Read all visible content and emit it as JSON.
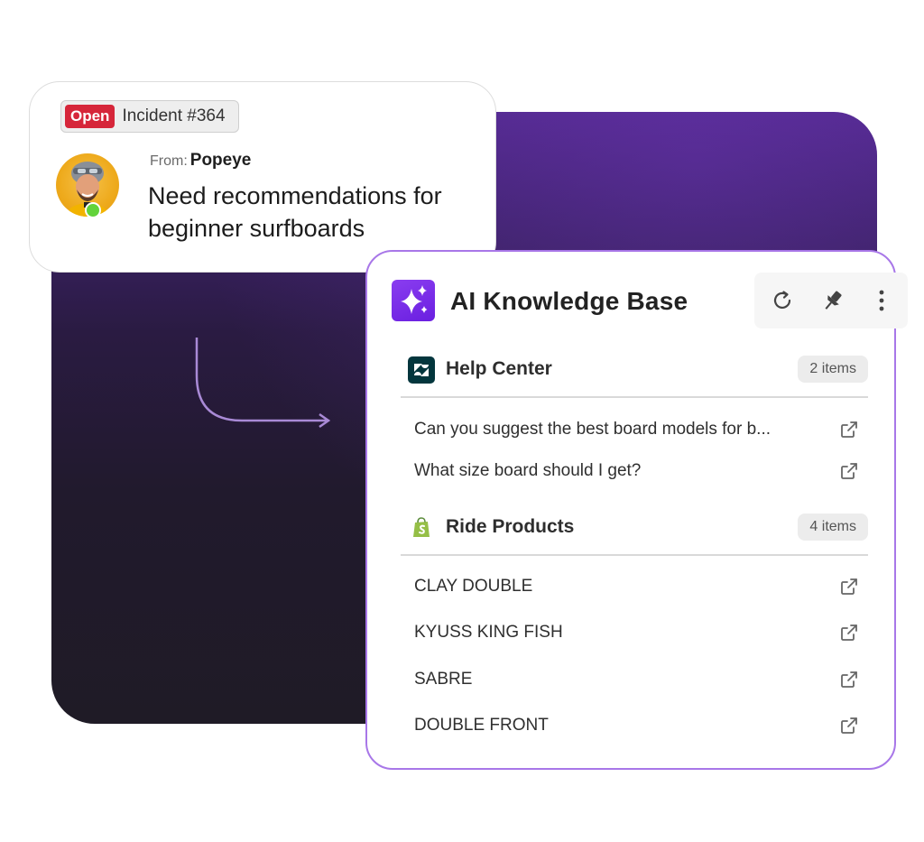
{
  "ticket": {
    "status": "Open",
    "incident": "Incident #364",
    "from_label": "From:",
    "from_name": "Popeye",
    "message": "Need recommendations for beginner surfboards"
  },
  "knowledge_base": {
    "title": "AI Knowledge Base",
    "actions": [
      {
        "name": "refresh",
        "icon": "refresh-icon"
      },
      {
        "name": "pin",
        "icon": "pin-icon"
      },
      {
        "name": "more",
        "icon": "more-vertical-icon"
      }
    ],
    "sections": [
      {
        "title": "Help Center",
        "icon": "zendesk-icon",
        "count": "2 items",
        "items": [
          "Can you suggest the best board models for b...",
          "What size board should I get?"
        ]
      },
      {
        "title": "Ride Products",
        "icon": "shopify-icon",
        "count": "4 items",
        "items": [
          "CLAY DOUBLE",
          "KYUSS KING FISH",
          "SABRE",
          "DOUBLE FRONT"
        ]
      }
    ]
  },
  "colors": {
    "accent": "#7b2ff0",
    "panel_border": "#a877e8",
    "status_open": "#d6263a",
    "online": "#62d33b"
  }
}
